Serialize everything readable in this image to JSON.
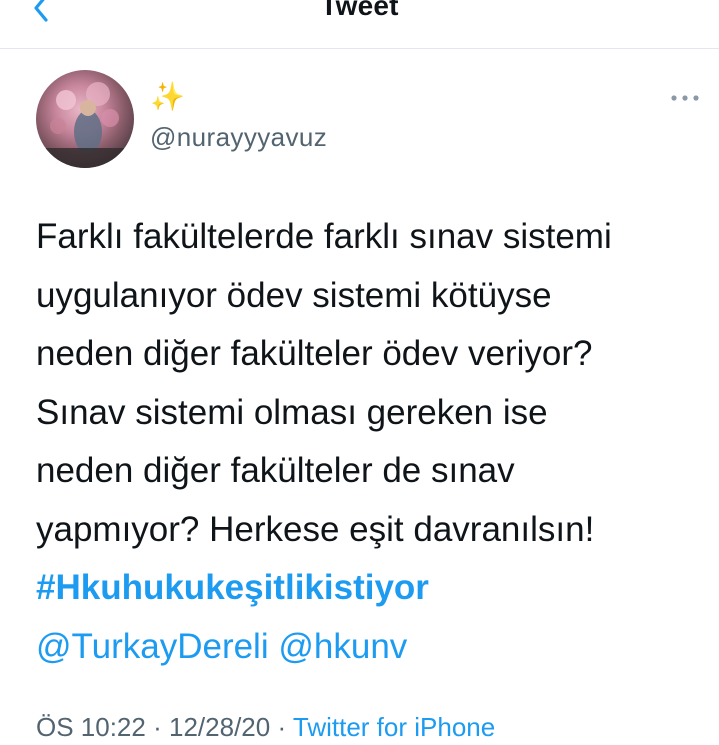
{
  "header": {
    "title": "Tweet",
    "back_icon": "chevron-left-icon"
  },
  "author": {
    "display_name": "✨",
    "handle": "@nurayyyavuz"
  },
  "more_icon": "more-horizontal-icon",
  "tweet": {
    "lines": [
      "Farklı fakültelerde farklı sınav sistemi",
      "uygulanıyor ödev sistemi kötüyse",
      "neden diğer fakülteler ödev veriyor?",
      "Sınav sistemi olması gereken ise",
      "neden diğer fakülteler de sınav",
      "yapmıyor? Herkese eşit davranılsın!"
    ],
    "hashtag": "#Hkuhukukeşitlikistiyor",
    "mentions": [
      "@TurkayDereli",
      "@hkunv"
    ]
  },
  "meta": {
    "time": "ÖS 10:22",
    "separator": "·",
    "date": "12/28/20",
    "source": "Twitter for iPhone"
  },
  "colors": {
    "accent": "#1d9bf0",
    "text": "#0f1419",
    "secondary": "#536471"
  }
}
